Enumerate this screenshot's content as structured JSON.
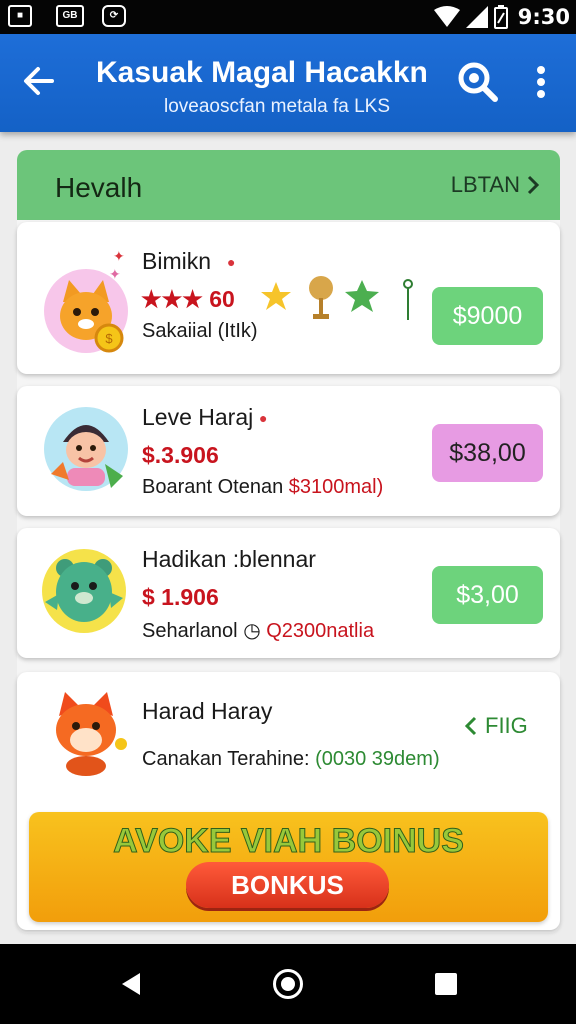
{
  "status_bar": {
    "time": "9:30"
  },
  "app_bar": {
    "title": "Kasuak Magal Hacakkn",
    "subtitle": "loveaoscfan metala fa LKS"
  },
  "section": {
    "title": "Hevalh",
    "link_label": "LBTAN"
  },
  "items": [
    {
      "name": "Bimikn",
      "price": "★★★ 60",
      "desc": "Sakaiial (ItIk)",
      "button": "$9000",
      "button_color": "#6dd37c"
    },
    {
      "name": "Leve Haraj",
      "price": "$.3.906",
      "desc": "Boarant Otenan",
      "desc_extra": "$3100mal)",
      "button": "$38,00",
      "button_color": "#e79be3"
    },
    {
      "name": "Hadikan :blennar",
      "price": "$ 1.906",
      "desc": "Seharlanol",
      "desc_extra": "Q2300natlia",
      "button": "$3,00",
      "button_color": "#6dd37c"
    },
    {
      "name": "Harad Haray",
      "desc": "Canakan Terahine:",
      "desc_extra": "(0030 39dem)",
      "action": "FIIG"
    }
  ],
  "bonus": {
    "title": "AVOKE VIAH BOINUS",
    "button": "BONKUS"
  },
  "colors": {
    "app_bar": "#1a68d0",
    "section_header": "#6cc57a",
    "price_red": "#c8141e",
    "bonus": "#f6b416"
  }
}
